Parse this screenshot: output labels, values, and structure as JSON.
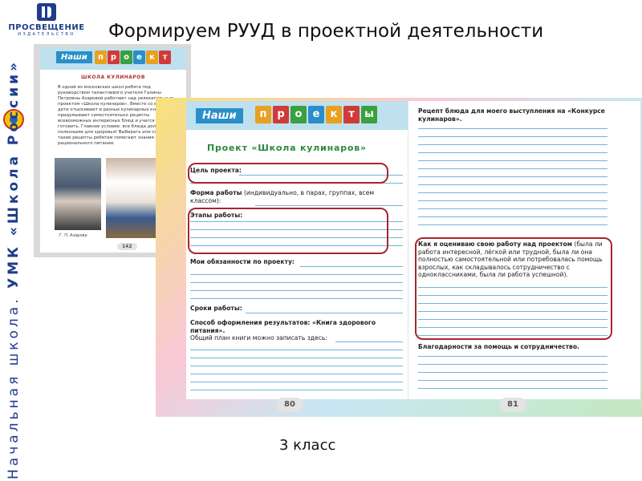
{
  "header": {
    "logo_name": "ПРОСВЕЩЕНИЕ",
    "logo_sub": "ИЗДАТЕЛЬСТВО",
    "title": "Формируем РУУД в проектной деятельности"
  },
  "side_banner": {
    "text_light": "Начальная школа.",
    "text_strong": "УМК «Школа России»"
  },
  "small_page": {
    "header_label": "Наши",
    "header_word": [
      "п",
      "р",
      "о",
      "е",
      "к",
      "т"
    ],
    "heading": "ШКОЛА КУЛИНАРОВ",
    "paragraph": "В одной из московских школ ребята под руководством талантливого учителя Галины Петровны Азаровой работают над увлекательным проектом «Школа кулинаров». Вместе со взрослыми дети отыскивают в разных кулинарных книгах или придумывают самостоятельно рецепты всевозможных интересных блюд и учатся их готовить. Главное условие: все блюда должны быть полезными для здоровья! Выбирать или создавать такие рецепты ребятам помогают знания о правилах рационального питания.",
    "caption": "Г. П. Азарова",
    "page_number": "142"
  },
  "spread": {
    "header_label": "Наши",
    "header_word": [
      "п",
      "р",
      "о",
      "е",
      "к",
      "т",
      "ы"
    ],
    "project_title": "Проект «Школа кулинаров»",
    "left": {
      "goal_label": "Цель проекта:",
      "form_label": "Форма работы",
      "form_text": "(индивидуально, в парах, группах, всем классом):",
      "stages_label": "Этапы работы:",
      "duties_label": "Мои обязанности по проекту:",
      "deadline_label": "Сроки работы:",
      "format_label": "Способ оформления результатов: «Книга здорового питания».",
      "plan_text": "Общий план книги можно записать здесь:",
      "page_number": "80"
    },
    "right": {
      "recipe_label": "Рецепт блюда для моего выступления на «Конкурсе кулинаров».",
      "evaluate_label": "Как я оцениваю свою работу над проектом",
      "evaluate_text": "(была ли работа интересной, лёгкой или трудной, была ли она полностью самостоятельной или потребовалась помощь взрослых, как складывалось сотрудничество с одноклассниками, была ли работа успешной).",
      "thanks_label": "Благодарности за помощь и сотрудничество.",
      "page_number": "81"
    }
  },
  "grade_label": "3 класс",
  "colors": {
    "brand_blue": "#1f3c8c",
    "header_blue": "#bfe0ee",
    "accent_green": "#2c8a3c",
    "highlight_red": "#a8262c",
    "rule_blue": "#6fb7d8"
  }
}
